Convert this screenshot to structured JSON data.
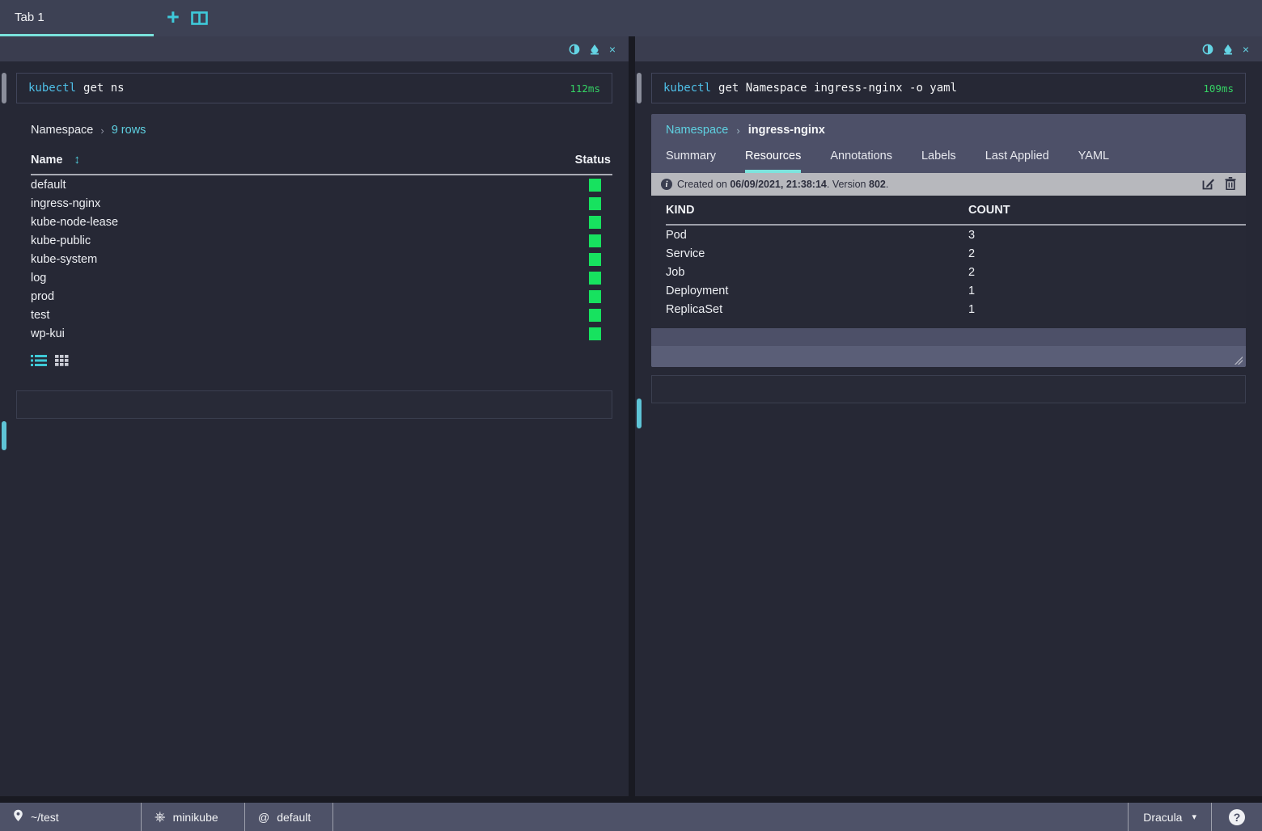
{
  "tabbar": {
    "tab1_label": "Tab 1"
  },
  "icons": {
    "close": "×",
    "plus": "+",
    "sort": "↕",
    "chevron": "›",
    "caret": "▾",
    "at": "@",
    "help": "?",
    "k8s": "⎈",
    "info": "i"
  },
  "left": {
    "command": {
      "name": "kubectl",
      "args": "get ns",
      "duration": "112ms"
    },
    "breadcrumb": {
      "kind": "Namespace",
      "rows_link": "9 rows"
    },
    "table": {
      "col_name": "Name",
      "col_status": "Status",
      "rows": [
        {
          "name": "default",
          "status": "green"
        },
        {
          "name": "ingress-nginx",
          "status": "green"
        },
        {
          "name": "kube-node-lease",
          "status": "green"
        },
        {
          "name": "kube-public",
          "status": "green"
        },
        {
          "name": "kube-system",
          "status": "green"
        },
        {
          "name": "log",
          "status": "green"
        },
        {
          "name": "prod",
          "status": "green"
        },
        {
          "name": "test",
          "status": "green"
        },
        {
          "name": "wp-kui",
          "status": "green"
        }
      ]
    }
  },
  "right": {
    "command": {
      "name": "kubectl",
      "args": "get Namespace ingress-nginx -o yaml",
      "duration": "109ms"
    },
    "sidecar": {
      "breadcrumb": {
        "kind": "Namespace",
        "resource": "ingress-nginx"
      },
      "tabs": [
        "Summary",
        "Resources",
        "Annotations",
        "Labels",
        "Last Applied",
        "YAML"
      ],
      "active_tab": "Resources",
      "toolbar": {
        "prefix": "Created on ",
        "date": "06/09/2021, 21:38:14",
        "mid": ". Version ",
        "version": "802",
        "suffix": "."
      },
      "table": {
        "col_kind": "KIND",
        "col_count": "COUNT",
        "rows": [
          {
            "kind": "Pod",
            "count": "3"
          },
          {
            "kind": "Service",
            "count": "2"
          },
          {
            "kind": "Job",
            "count": "2"
          },
          {
            "kind": "Deployment",
            "count": "1"
          },
          {
            "kind": "ReplicaSet",
            "count": "1"
          }
        ]
      }
    }
  },
  "statusbar": {
    "cwd": "~/test",
    "context": "minikube",
    "namespace": "default",
    "theme": "Dracula"
  },
  "colors": {
    "accent_teal": "#5ed0e0",
    "status_green": "#17e25f",
    "duration_green": "#35d364",
    "card_bg": "#4d5068",
    "toolbar_bg": "#b7b8bd",
    "tab_underline": "#79e2dc"
  }
}
